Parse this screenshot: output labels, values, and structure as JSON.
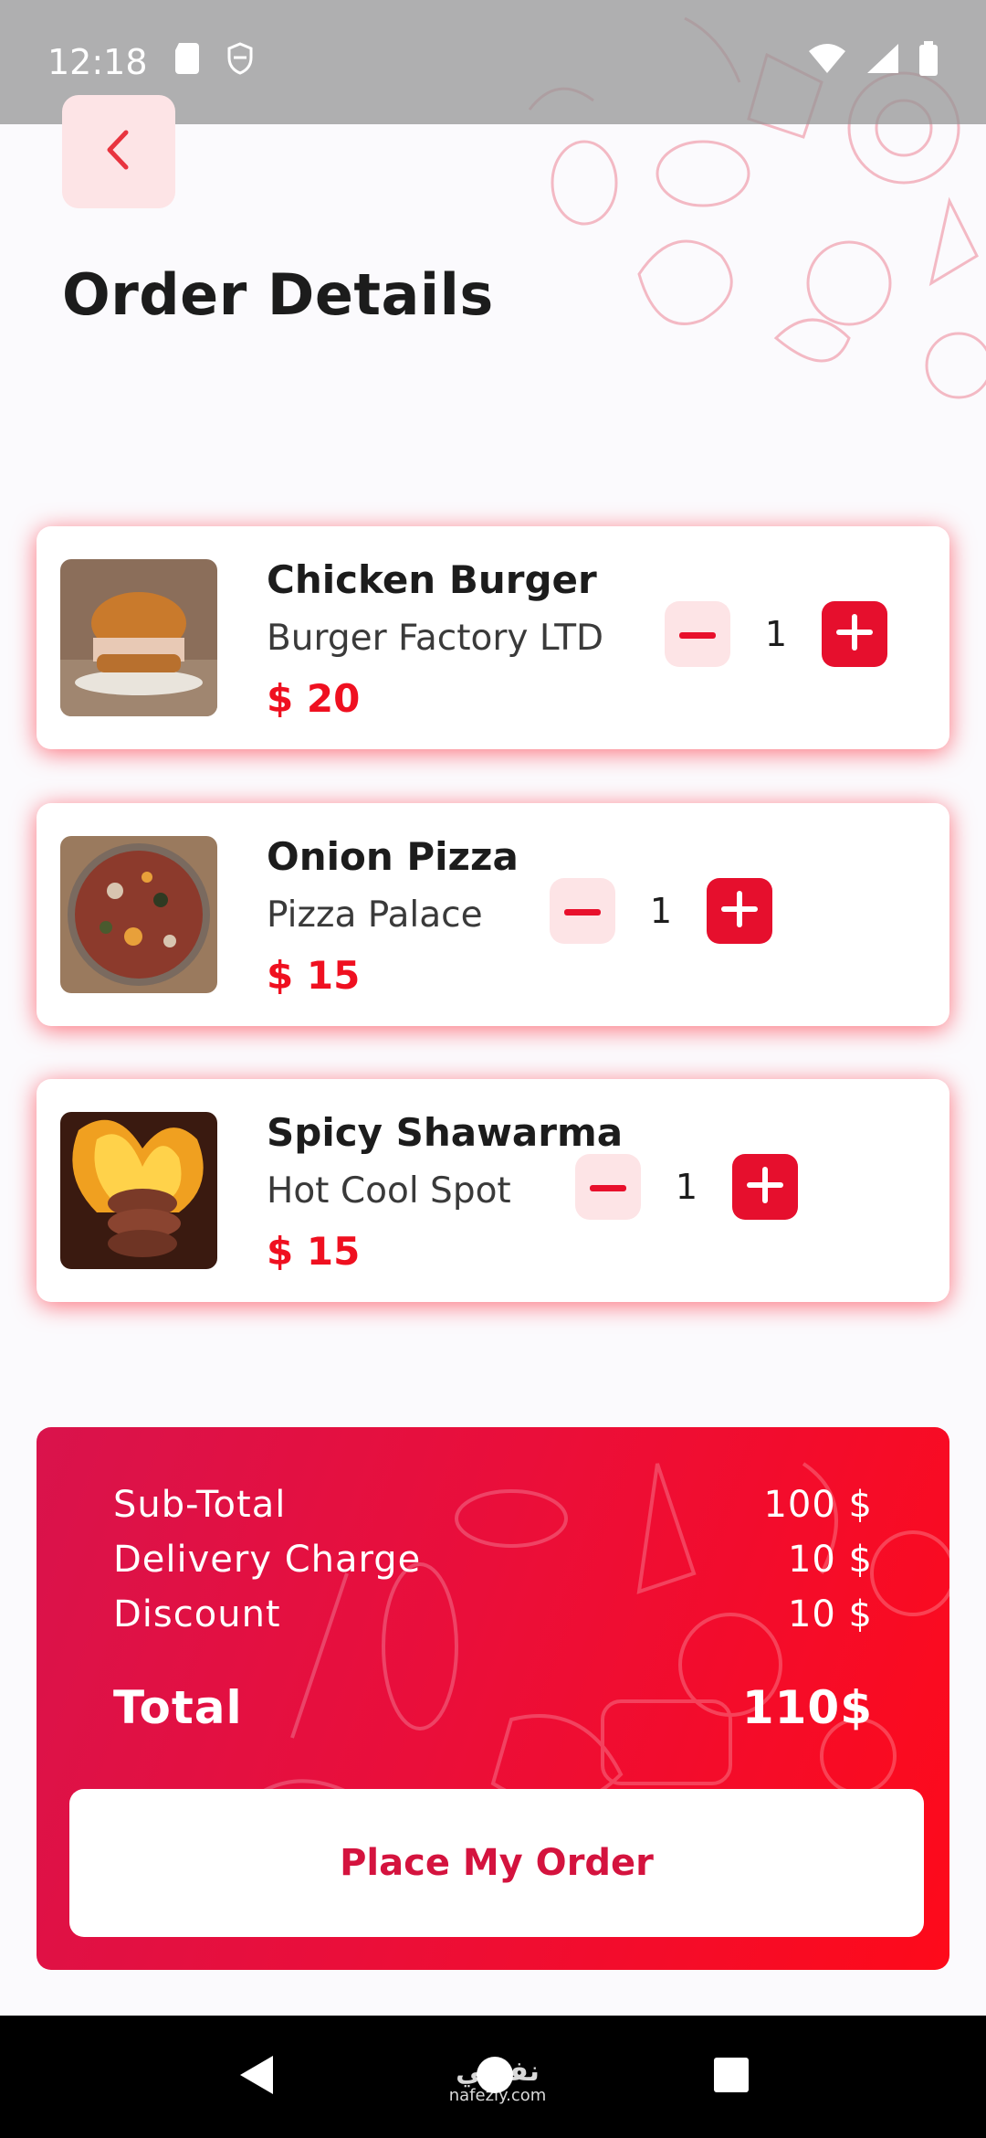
{
  "status_bar": {
    "time": "12:18",
    "icons": [
      "sd-card-icon",
      "vpn-icon",
      "wifi-icon",
      "signal-icon",
      "battery-icon"
    ]
  },
  "header": {
    "back_icon": "chevron-left-icon",
    "title": "Order Details"
  },
  "items": [
    {
      "name": "Chicken Burger",
      "vendor": "Burger Factory LTD",
      "price": "$ 20",
      "quantity": "1",
      "image": "burger-photo"
    },
    {
      "name": "Onion Pizza",
      "vendor": "Pizza Palace",
      "price": "$ 15",
      "quantity": "1",
      "image": "pizza-photo"
    },
    {
      "name": "Spicy Shawarma",
      "vendor": "Hot Cool Spot",
      "price": "$ 15",
      "quantity": "1",
      "image": "shawarma-photo"
    }
  ],
  "summary": {
    "subtotal_label": "Sub-Total",
    "subtotal_value": "100 $",
    "delivery_label": "Delivery Charge",
    "delivery_value": "10 $",
    "discount_label": "Discount",
    "discount_value": "10 $",
    "total_label": "Total",
    "total_value": "110$",
    "place_order_label": "Place My Order"
  },
  "watermark": {
    "main": "نفذلي",
    "sub": "nafezly.com"
  },
  "colors": {
    "accent": "#e60f2d",
    "price": "#ef1020",
    "soft_accent": "#fde4e6",
    "gradient_start": "#d9134c",
    "gradient_end": "#fe0a1a"
  }
}
